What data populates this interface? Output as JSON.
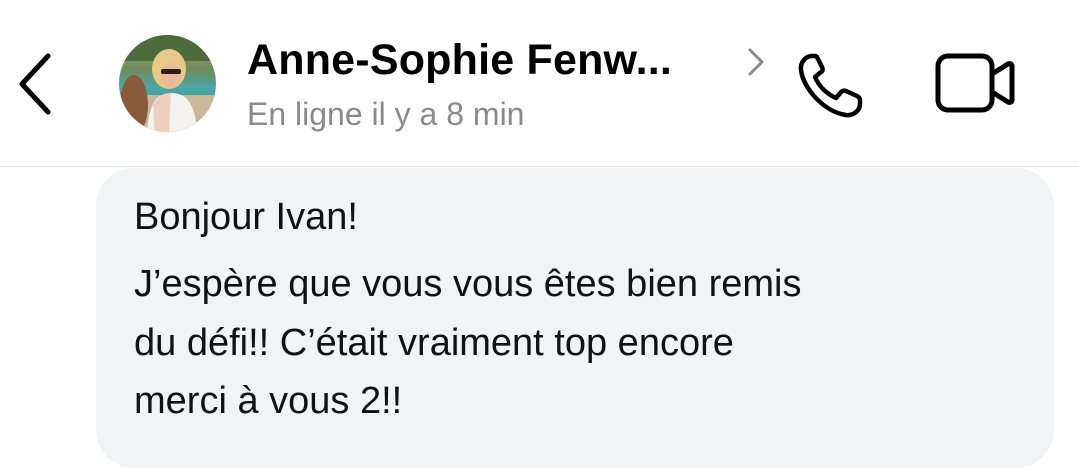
{
  "header": {
    "contact_name": "Anne-Sophie Fenw...",
    "presence": "En ligne il y a 8 min",
    "icons": {
      "back": "chevron-left-icon",
      "profile": "chevron-right-icon",
      "call": "phone-icon",
      "video": "video-camera-icon"
    }
  },
  "message": {
    "lines": [
      "Bonjour Ivan!",
      "J’espère que vous vous êtes bien remis",
      "du défi!! C’était vraiment top encore",
      "merci à vous 2!!"
    ]
  }
}
